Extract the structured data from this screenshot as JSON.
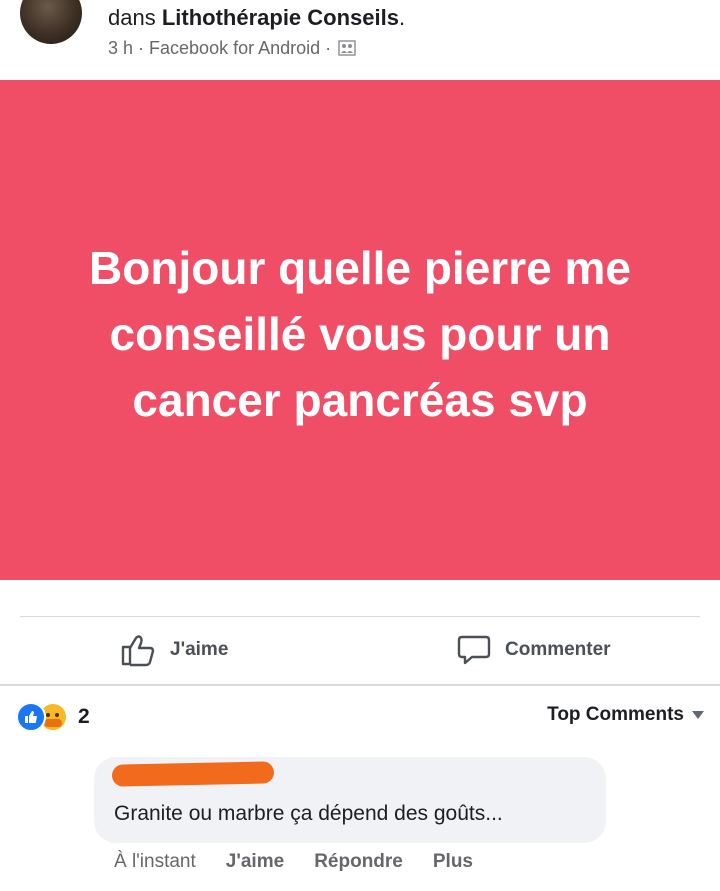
{
  "header": {
    "prefix": "dans ",
    "group": "Lithothérapie Conseils",
    "suffix": ".",
    "time": "3 h",
    "separator": " · ",
    "app": "Facebook for Android",
    "audience_icon": "group-audience-icon"
  },
  "post": {
    "text": "Bonjour quelle pierre me conseillé vous pour un cancer pancréas svp",
    "background_color": "#f04e67",
    "text_color": "#ffffff"
  },
  "actions": {
    "like_label": "J'aime",
    "comment_label": "Commenter",
    "like_icon": "thumbs-up-icon",
    "comment_icon": "speech-bubble-icon"
  },
  "reactions": {
    "count": "2",
    "icons": [
      "like-reaction-icon",
      "care-reaction-icon"
    ]
  },
  "sort": {
    "label": "Top Comments"
  },
  "comment": {
    "text": "Granite ou marbre ça dépend des goûts...",
    "time": "À l'instant",
    "like": "J'aime",
    "reply": "Répondre",
    "more": "Plus",
    "redaction_color": "#f26b1d"
  }
}
